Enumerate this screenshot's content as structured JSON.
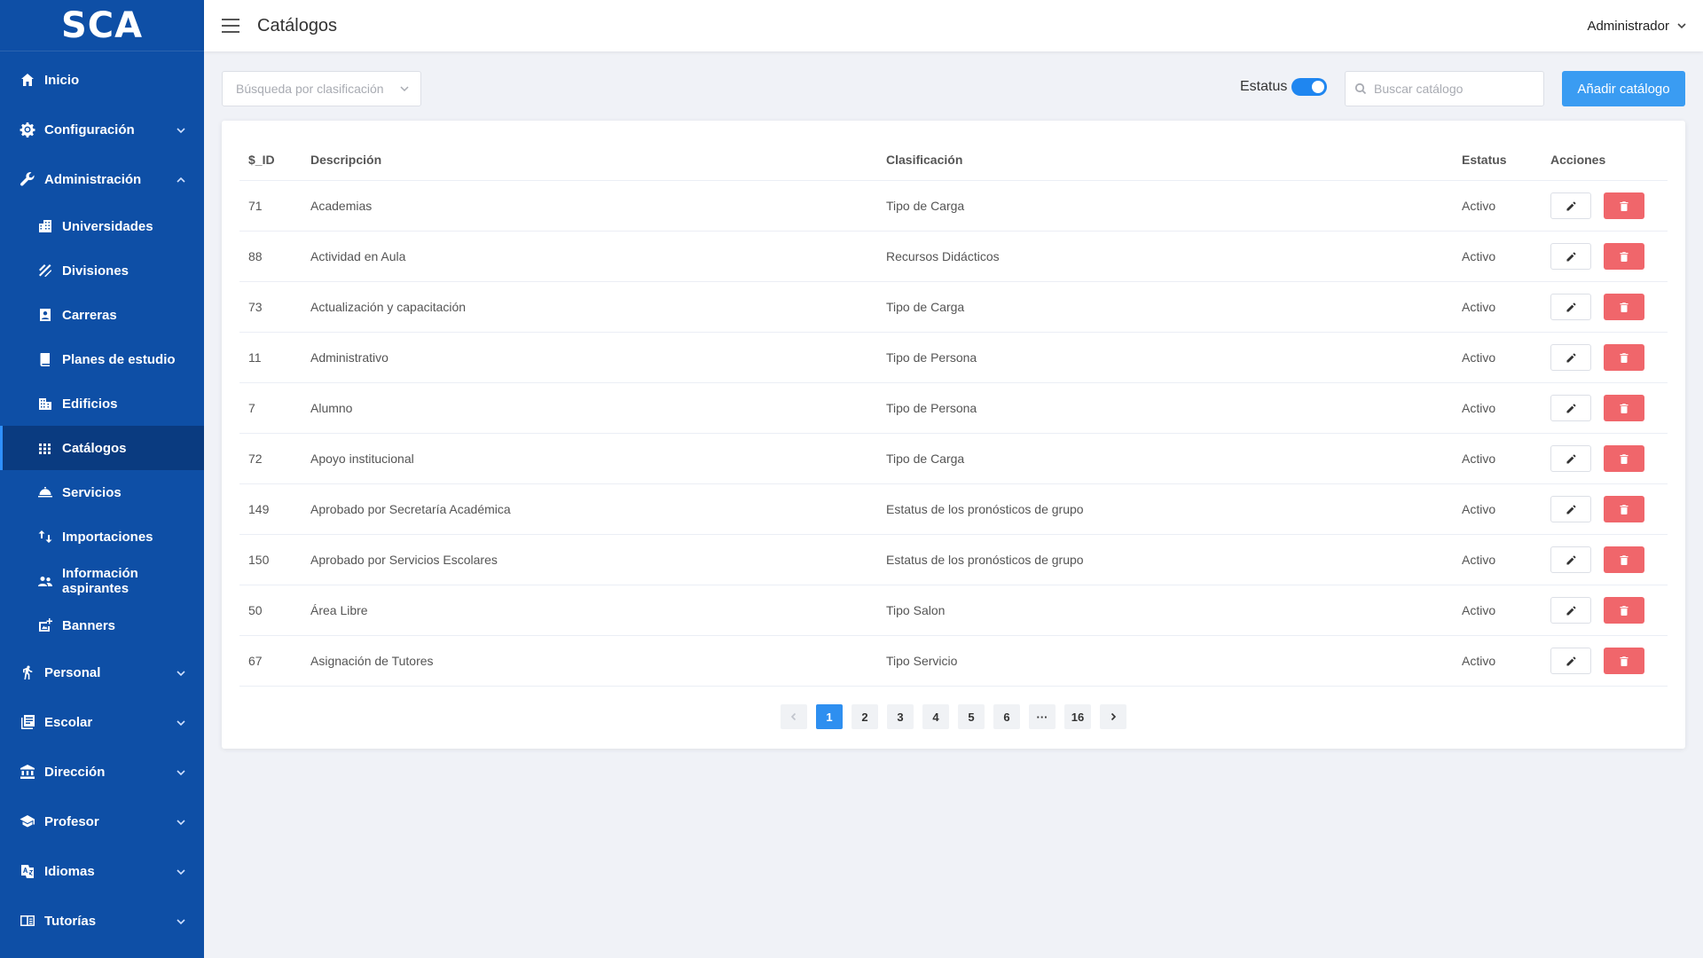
{
  "app": {
    "logo": "SCA"
  },
  "sidebar": {
    "items": [
      {
        "label": "Inicio",
        "icon": "home-icon",
        "level": "top",
        "expandable": false
      },
      {
        "label": "Configuración",
        "icon": "gear-icon",
        "level": "top",
        "expandable": true,
        "expanded": false
      },
      {
        "label": "Administración",
        "icon": "wrench-icon",
        "level": "top",
        "expandable": true,
        "expanded": true
      },
      {
        "label": "Universidades",
        "icon": "buildings-icon",
        "level": "sub"
      },
      {
        "label": "Divisiones",
        "icon": "stripes-icon",
        "level": "sub"
      },
      {
        "label": "Carreras",
        "icon": "contact-card-icon",
        "level": "sub"
      },
      {
        "label": "Planes de estudio",
        "icon": "book-icon",
        "level": "sub"
      },
      {
        "label": "Edificios",
        "icon": "building-icon",
        "level": "sub"
      },
      {
        "label": "Catálogos",
        "icon": "grid-icon",
        "level": "sub",
        "active": true
      },
      {
        "label": "Servicios",
        "icon": "service-bell-icon",
        "level": "sub"
      },
      {
        "label": "Importaciones",
        "icon": "swap-arrows-icon",
        "level": "sub"
      },
      {
        "label": "Información aspirantes",
        "icon": "people-icon",
        "level": "sub"
      },
      {
        "label": "Banners",
        "icon": "add-photo-icon",
        "level": "sub"
      },
      {
        "label": "Personal",
        "icon": "walking-person-icon",
        "level": "top",
        "expandable": true,
        "expanded": false
      },
      {
        "label": "Escolar",
        "icon": "library-books-icon",
        "level": "top",
        "expandable": true,
        "expanded": false
      },
      {
        "label": "Dirección",
        "icon": "bank-icon",
        "level": "top",
        "expandable": true,
        "expanded": false
      },
      {
        "label": "Profesor",
        "icon": "graduation-cap-icon",
        "level": "top",
        "expandable": true,
        "expanded": false
      },
      {
        "label": "Idiomas",
        "icon": "translate-icon",
        "level": "top",
        "expandable": true,
        "expanded": false
      },
      {
        "label": "Tutorías",
        "icon": "chrome-reader-icon",
        "level": "top",
        "expandable": true,
        "expanded": false
      }
    ]
  },
  "header": {
    "title": "Catálogos",
    "user": "Administrador"
  },
  "toolbar": {
    "filter_placeholder": "Búsqueda por clasificación",
    "status_label": "Estatus",
    "status_on": true,
    "search_placeholder": "Buscar catálogo",
    "add_label": "Añadir catálogo"
  },
  "colors": {
    "sidebar": "#0e4fa6",
    "accent": "#3a9cf2",
    "danger": "#f0666b"
  },
  "table": {
    "headers": {
      "id": "$_ID",
      "desc": "Descripción",
      "clas": "Clasificación",
      "est": "Estatus",
      "acc": "Acciones"
    },
    "rows": [
      {
        "id": "71",
        "desc": "Academias",
        "clas": "Tipo de Carga",
        "est": "Activo"
      },
      {
        "id": "88",
        "desc": "Actividad en Aula",
        "clas": "Recursos Didácticos",
        "est": "Activo"
      },
      {
        "id": "73",
        "desc": "Actualización y capacitación",
        "clas": "Tipo de Carga",
        "est": "Activo"
      },
      {
        "id": "11",
        "desc": "Administrativo",
        "clas": "Tipo de Persona",
        "est": "Activo"
      },
      {
        "id": "7",
        "desc": "Alumno",
        "clas": "Tipo de Persona",
        "est": "Activo"
      },
      {
        "id": "72",
        "desc": "Apoyo institucional",
        "clas": "Tipo de Carga",
        "est": "Activo"
      },
      {
        "id": "149",
        "desc": "Aprobado por Secretaría Académica",
        "clas": "Estatus de los pronósticos de grupo",
        "est": "Activo"
      },
      {
        "id": "150",
        "desc": "Aprobado por Servicios Escolares",
        "clas": "Estatus de los pronósticos de grupo",
        "est": "Activo"
      },
      {
        "id": "50",
        "desc": "Área Libre",
        "clas": "Tipo Salon",
        "est": "Activo"
      },
      {
        "id": "67",
        "desc": "Asignación de Tutores",
        "clas": "Tipo Servicio",
        "est": "Activo"
      }
    ]
  },
  "pagination": {
    "pages": [
      "1",
      "2",
      "3",
      "4",
      "5",
      "6",
      "···",
      "16"
    ],
    "current": "1"
  }
}
